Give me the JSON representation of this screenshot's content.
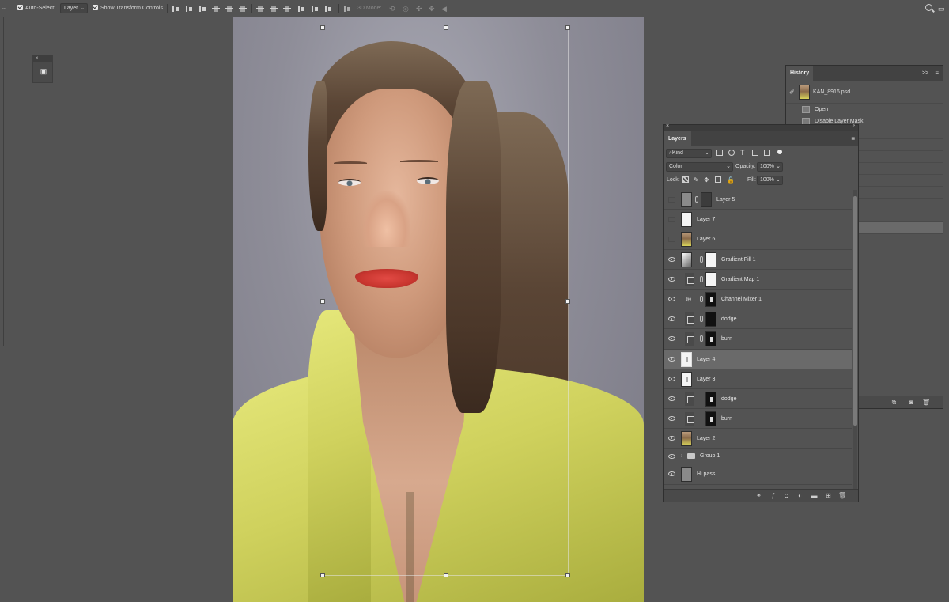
{
  "options_bar": {
    "auto_select_label": "Auto-Select:",
    "auto_select_value": "Layer",
    "show_transform_label": "Show Transform Controls",
    "mode_3d_label": "3D Mode:"
  },
  "history": {
    "title": "History",
    "collapse_label": ">>",
    "snapshot_name": "KAN_8916.psd",
    "items": [
      {
        "label": "Open"
      },
      {
        "label": "Disable Layer Mask"
      }
    ]
  },
  "layers": {
    "title": "Layers",
    "filter_kind": "Kind",
    "blend_mode": "Color",
    "opacity_label": "Opacity:",
    "opacity_value": "100%",
    "lock_label": "Lock:",
    "fill_label": "Fill:",
    "fill_value": "100%",
    "rows": [
      {
        "name": "Layer 5",
        "visible": false
      },
      {
        "name": "Layer 7",
        "visible": false
      },
      {
        "name": "Layer 6",
        "visible": false
      },
      {
        "name": "Gradient Fill 1",
        "visible": true
      },
      {
        "name": "Gradient Map 1",
        "visible": true
      },
      {
        "name": "Channel Mixer 1",
        "visible": true
      },
      {
        "name": "dodge",
        "visible": true
      },
      {
        "name": "burn",
        "visible": true
      },
      {
        "name": "Layer 4",
        "visible": true,
        "selected": true
      },
      {
        "name": "Layer 3",
        "visible": true
      },
      {
        "name": "dodge",
        "visible": true
      },
      {
        "name": "burn",
        "visible": true
      },
      {
        "name": "Layer 2",
        "visible": true
      },
      {
        "name": "Group 1",
        "visible": true
      },
      {
        "name": "Hi pass",
        "visible": true
      }
    ]
  },
  "colors": {
    "ui_background": "#535353",
    "panel_header": "#424242",
    "selected_row": "#6a6a6a",
    "coat_yellow": "#d6d85f",
    "lip_red": "#d23c36"
  }
}
